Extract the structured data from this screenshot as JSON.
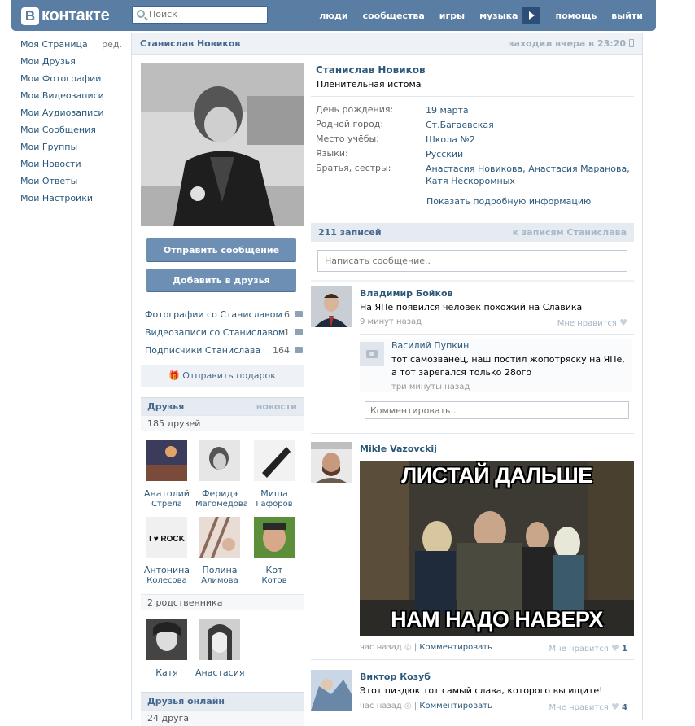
{
  "header": {
    "logo_mark": "B",
    "logo_text": "контакте",
    "search_placeholder": "Поиск",
    "nav": [
      "люди",
      "сообщества",
      "игры",
      "музыка",
      "помощь",
      "выйти"
    ]
  },
  "left_menu": {
    "edit_label": "ред.",
    "items": [
      "Моя Страница",
      "Мои Друзья",
      "Мои Фотографии",
      "Мои Видеозаписи",
      "Мои Аудиозаписи",
      "Мои Сообщения",
      "Мои Группы",
      "Мои Новости",
      "Мои Ответы",
      "Мои Настройки"
    ]
  },
  "profile": {
    "name_header": "Станислав Новиков",
    "last_seen": "заходил вчера в 23:20",
    "name": "Станислав Новиков",
    "status": "Пленительная истома",
    "info": [
      {
        "key": "День рождения:",
        "value": "19 марта"
      },
      {
        "key": "Родной город:",
        "value": "Ст.Багаевская"
      },
      {
        "key": "Место учёбы:",
        "value": "Школа №2"
      },
      {
        "key": "Языки:",
        "value": "Русский"
      },
      {
        "key": "Братья, сестры:",
        "value": "Анастасия Новикова, Анастасия Маранова, Катя Нескоромных"
      }
    ],
    "show_more": "Показать подробную информацию"
  },
  "actions": {
    "send_message": "Отправить сообщение",
    "add_friend": "Добавить в друзья",
    "photos_with": "Фотографии со Станиславом",
    "photos_count": "6",
    "videos_with": "Видеозаписи со Станиславом",
    "videos_count": "1",
    "followers": "Подписчики Станислава",
    "followers_count": "164",
    "gift": "Отправить подарок"
  },
  "friends": {
    "title": "Друзья",
    "news_link": "новости",
    "count": "185 друзей",
    "list": [
      {
        "first": "Анатолий",
        "last": "Стрела"
      },
      {
        "first": "Феридэ",
        "last": "Магомедова"
      },
      {
        "first": "Миша",
        "last": "Гафоров"
      },
      {
        "first": "Антонина",
        "last": "Колесова"
      },
      {
        "first": "Полина",
        "last": "Алимова"
      },
      {
        "first": "Кот",
        "last": "Котов"
      }
    ],
    "relatives_count": "2 родственника",
    "relatives": [
      "Катя",
      "Анастасия"
    ],
    "online_title": "Друзья онлайн",
    "online_count": "24 друга"
  },
  "wall": {
    "count": "211 записей",
    "to_posts": "к записям Станислава",
    "compose_placeholder": "Написать сообщение..",
    "posts": [
      {
        "author": "Владимир Бойков",
        "text": "На ЯПе появился человек похожий на Славика",
        "time": "9 минут назад",
        "like": "Мне нравится",
        "reply_author": "Василий Пупкин",
        "reply_text": "тот самозванец, наш постил жопотряску на ЯПе, а тот зарегался только 28ого",
        "reply_time": "три минуты назад",
        "comment_placeholder": "Комментировать.."
      },
      {
        "author": "Mikle Vazovckij",
        "meme_top": "ЛИСТАЙ ДАЛЬШЕ",
        "meme_bottom": "НАМ НАДО НАВЕРХ",
        "time": "час назад",
        "comment": "Комментировать",
        "like": "Мне нравится",
        "like_count": "1"
      },
      {
        "author": "Виктор Козуб",
        "text": "Этот пиздюк тот самый слава, которого вы ищите!",
        "time": "час назад",
        "comment": "Комментировать",
        "like": "Мне нравится",
        "like_count": "4"
      }
    ]
  }
}
